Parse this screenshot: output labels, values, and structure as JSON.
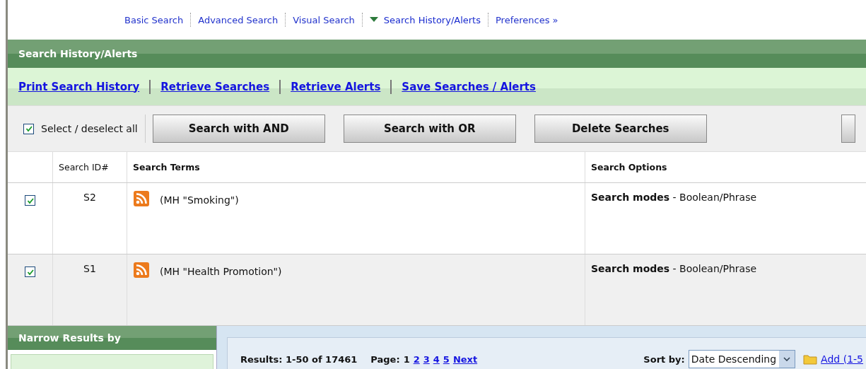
{
  "top_nav": [
    {
      "label": "Basic Search",
      "selected": false
    },
    {
      "label": "Advanced Search",
      "selected": false
    },
    {
      "label": "Visual Search",
      "selected": false
    },
    {
      "label": "Search History/Alerts",
      "selected": true
    },
    {
      "label": "Preferences »",
      "selected": false
    }
  ],
  "panel": {
    "title": "Search History/Alerts",
    "links": [
      "Print Search History",
      "Retrieve Searches",
      "Retrieve Alerts",
      "Save Searches / Alerts"
    ],
    "select_all": {
      "label": "Select / deselect all",
      "checked": true
    },
    "buttons": [
      "Search with AND",
      "Search with OR",
      "Delete Searches"
    ],
    "table": {
      "columns": [
        "Search ID#",
        "Search Terms",
        "Search Options"
      ],
      "rows": [
        {
          "checked": true,
          "id": "S2",
          "terms": "(MH \"Smoking\")",
          "options": "**Search modes** - Boolean/Phrase"
        },
        {
          "checked": true,
          "id": "S1",
          "terms": "(MH \"Health Promotion\")",
          "options": "**Search modes** - Boolean/Phrase"
        }
      ]
    }
  },
  "narrow": {
    "title": "Narrow Results by"
  },
  "results": {
    "summary": "Results: 1-50 of 17461",
    "page_label": "Page:",
    "pages": [
      {
        "label": "1",
        "selected": true
      },
      {
        "label": "2",
        "selected": false
      },
      {
        "label": "3",
        "selected": false
      },
      {
        "label": "4",
        "selected": false
      },
      {
        "label": "5",
        "selected": false
      }
    ],
    "next": "Next",
    "sort_label": "Sort by:",
    "sort_value": "Date Descending",
    "add": "Add (1-5"
  }
}
